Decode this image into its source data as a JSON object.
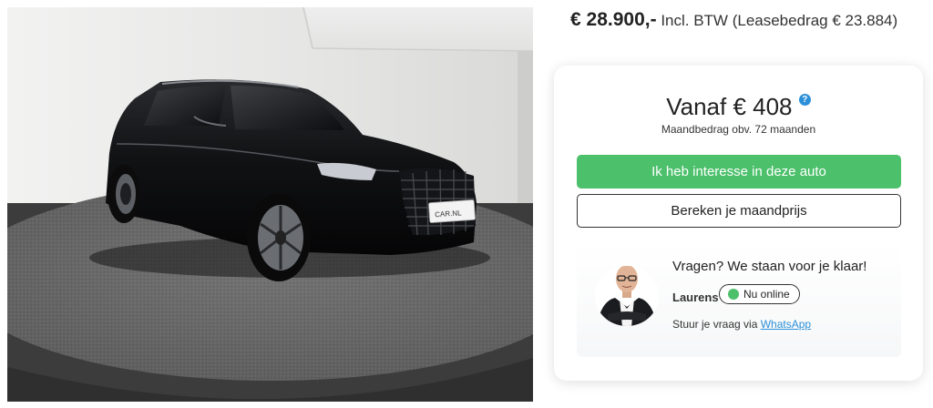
{
  "listing": {
    "price": "€ 28.900,-",
    "price_suffix": "Incl. BTW (Leasebedrag € 23.884)",
    "photo_plate_text": "CAR.NL"
  },
  "finance_card": {
    "from_label": "Vanaf € 408",
    "help_symbol": "?",
    "monthly_note": "Maandbedrag obv. 72 maanden",
    "interest_button": "Ik heb interesse in deze auto",
    "calculate_button": "Bereken je maandprijs"
  },
  "contact": {
    "title": "Vragen? We staan voor je klaar!",
    "agent_name": "Laurens",
    "status": "Nu online",
    "whatsapp_prefix": "Stuur je vraag via",
    "whatsapp_link": "WhatsApp"
  },
  "colors": {
    "accent_green": "#4cc06b",
    "link_blue": "#2b90d9",
    "text_dark": "#222222"
  }
}
